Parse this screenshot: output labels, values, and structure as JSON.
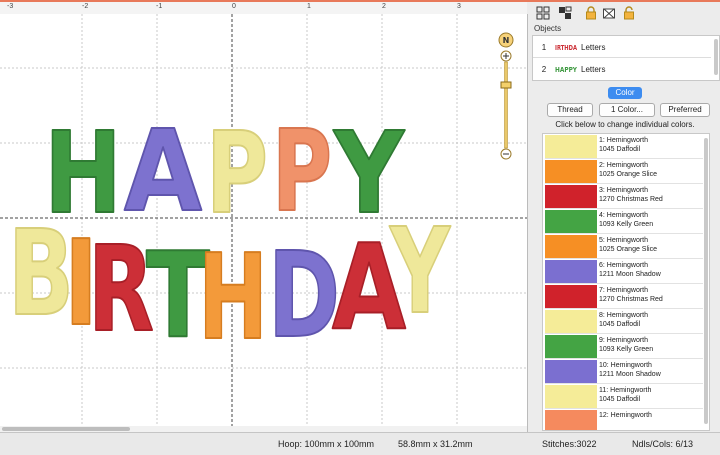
{
  "canvas": {
    "ruler_labels": [
      "-3",
      "-2",
      "-1",
      "0",
      "1",
      "2",
      "3"
    ],
    "zoom_icon": "compass-zoom-icon",
    "letter_colors": {
      "daffodil": "#efe89a",
      "orange": "#f39a3a",
      "red": "#cc2f37",
      "green": "#3f9a42",
      "moon": "#7d72cf",
      "salmon": "#f0926a"
    }
  },
  "toolbar": {
    "icons": [
      "select-tool-icon",
      "ungroup-icon",
      "lock-icon",
      "hide-icon",
      "unlock-icon"
    ]
  },
  "objects": {
    "title": "Objects",
    "items": [
      {
        "num": "1",
        "label": "Letters",
        "thumb_text": "IRTHDA"
      },
      {
        "num": "2",
        "label": "Letters",
        "thumb_text": "HAPPY"
      }
    ]
  },
  "color_panel": {
    "tab_label": "Color",
    "buttons": {
      "thread": "Thread",
      "one_color": "1 Color...",
      "preferred": "Preferred"
    },
    "hint": "Click below to change individual colors.",
    "rows": [
      {
        "line1": "1: Hemingworth",
        "line2": "1045 Daffodil",
        "color": "#f5ec98"
      },
      {
        "line1": "2: Hemingworth",
        "line2": "1025 Orange Slice",
        "color": "#f68f24"
      },
      {
        "line1": "3: Hemingworth",
        "line2": "1270 Christmas Red",
        "color": "#d0222b"
      },
      {
        "line1": "4: Hemingworth",
        "line2": "1093 Kelly Green",
        "color": "#44a444"
      },
      {
        "line1": "5: Hemingworth",
        "line2": "1025 Orange Slice",
        "color": "#f68f24"
      },
      {
        "line1": "6: Hemingworth",
        "line2": "1211 Moon Shadow",
        "color": "#7b6fd0"
      },
      {
        "line1": "7: Hemingworth",
        "line2": "1270 Christmas Red",
        "color": "#d0222b"
      },
      {
        "line1": "8: Hemingworth",
        "line2": "1045 Daffodil",
        "color": "#f5ec98"
      },
      {
        "line1": "9: Hemingworth",
        "line2": "1093 Kelly Green",
        "color": "#44a444"
      },
      {
        "line1": "10: Hemingworth",
        "line2": "1211 Moon Shadow",
        "color": "#7b6fd0"
      },
      {
        "line1": "11: Hemingworth",
        "line2": "1045 Daffodil",
        "color": "#f5ec98"
      },
      {
        "line1": "12: Hemingworth",
        "line2": "",
        "color": "#f58a5e"
      }
    ]
  },
  "status": {
    "hoop": "Hoop: 100mm x 100mm",
    "size": "58.8mm x 31.2mm",
    "stitches": "Stitches:3022",
    "ndls": "Ndls/Cols: 6/13"
  }
}
